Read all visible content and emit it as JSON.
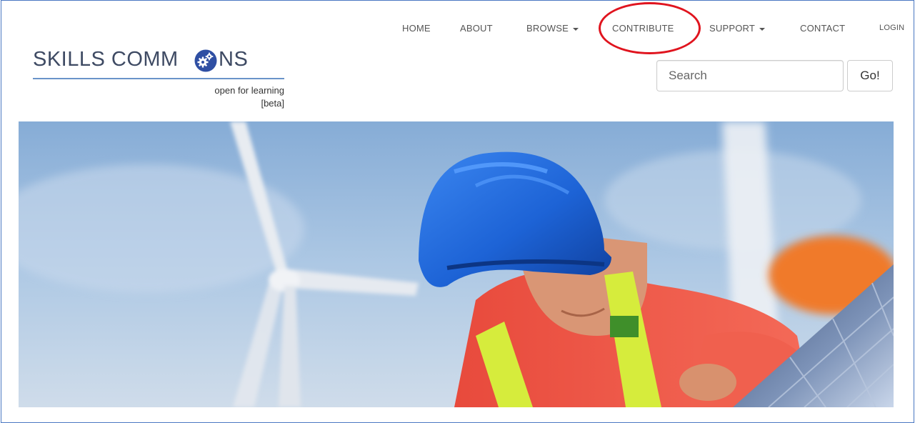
{
  "nav": {
    "items": [
      {
        "label": "HOME",
        "dropdown": false
      },
      {
        "label": "ABOUT",
        "dropdown": false
      },
      {
        "label": "BROWSE",
        "dropdown": true
      },
      {
        "label": "CONTRIBUTE",
        "dropdown": false,
        "annotated": true
      },
      {
        "label": "SUPPORT",
        "dropdown": true
      },
      {
        "label": "CONTACT",
        "dropdown": false
      },
      {
        "label": "LOGIN",
        "dropdown": false
      }
    ]
  },
  "logo": {
    "word_left": "SKILLS COMM",
    "word_right": "NS",
    "tagline": "open for learning",
    "badge": "[beta]"
  },
  "search": {
    "placeholder": "Search",
    "button_label": "Go!"
  },
  "hero": {
    "image": "worker-hard-hat-wind-turbine-solar-panel"
  },
  "colors": {
    "annotation": "#e0141e",
    "frame_border": "#4a78c2",
    "logo_text": "#3e4a63",
    "logo_rule": "#6a93c9",
    "hard_hat": "#1f66d8",
    "shirt": "#f05a4a",
    "safety_vest": "#d6ec3c"
  }
}
